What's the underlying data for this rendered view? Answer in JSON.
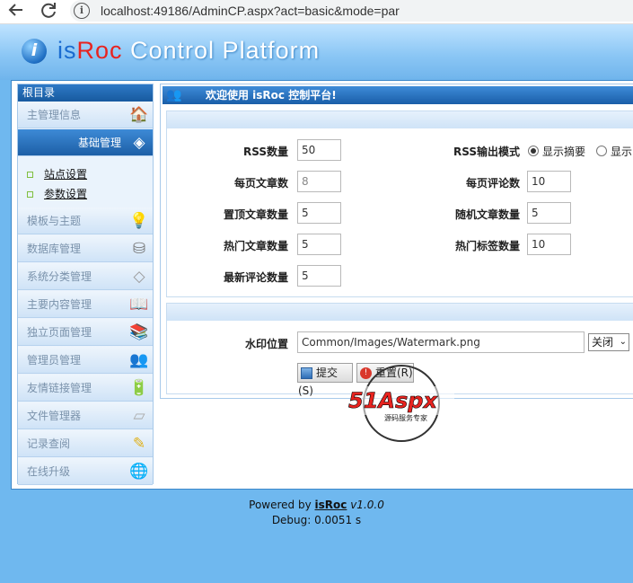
{
  "browser": {
    "url": "localhost:49186/AdminCP.aspx?act=basic&mode=par",
    "back_icon": "arrow-left-icon",
    "reload_icon": "reload-icon",
    "info_icon": "info-icon"
  },
  "banner": {
    "brand_is": "is",
    "brand_roc": "Roc",
    "brand_rest": " Control Platform"
  },
  "sidebar": {
    "header": "根目录",
    "items": [
      {
        "label": "主管理信息",
        "icon": "house-icon"
      },
      {
        "label": "基础管理",
        "icon": "settings-cube-icon",
        "active": true
      },
      {
        "label": "模板与主题",
        "icon": "lightbulb-icon"
      },
      {
        "label": "数据库管理",
        "icon": "database-icon"
      },
      {
        "label": "系统分类管理",
        "icon": "tag-icon"
      },
      {
        "label": "主要内容管理",
        "icon": "book-icon"
      },
      {
        "label": "独立页面管理",
        "icon": "books-icon"
      },
      {
        "label": "管理员管理",
        "icon": "users-icon"
      },
      {
        "label": "友情链接管理",
        "icon": "battery-icon"
      },
      {
        "label": "文件管理器",
        "icon": "eraser-icon"
      },
      {
        "label": "记录查阅",
        "icon": "pencil-icon"
      },
      {
        "label": "在线升级",
        "icon": "globe-icon"
      }
    ],
    "subitems": [
      {
        "label": "站点设置"
      },
      {
        "label": "参数设置"
      }
    ]
  },
  "content": {
    "header_title": "欢迎使用 isRoc 控制平台!",
    "fields": {
      "rss_count_label": "RSS数量",
      "rss_count_value": "50",
      "rss_mode_label": "RSS输出模式",
      "rss_mode_opt1": "显示摘要",
      "rss_mode_opt2": "显示",
      "per_page_label": "每页文章数",
      "per_page_value": "8",
      "per_page_comments_label": "每页评论数",
      "per_page_comments_value": "10",
      "top_label": "置顶文章数量",
      "top_value": "5",
      "random_label": "随机文章数量",
      "random_value": "5",
      "hot_label": "热门文章数量",
      "hot_value": "5",
      "hot_tags_label": "热门标签数量",
      "hot_tags_value": "10",
      "latest_comments_label": "最新评论数量",
      "latest_comments_value": "5"
    },
    "watermark": {
      "label": "水印位置",
      "path": "Common/Images/Watermark.png",
      "select_value": "关闭"
    },
    "buttons": {
      "submit": "提交(S)",
      "reset": "重置(R)"
    }
  },
  "footer": {
    "powered_by": "Powered by ",
    "brand": "isRoc",
    "version": "v1.0.0",
    "debug": "Debug: 0.0051 s"
  },
  "overlay": {
    "brand": "51Aspx",
    "tagline": "源码服务专家"
  },
  "colors": {
    "page_bg": "#6fb8ef",
    "header_blue": "#1d5fa6",
    "accent_red": "#e8231f"
  }
}
